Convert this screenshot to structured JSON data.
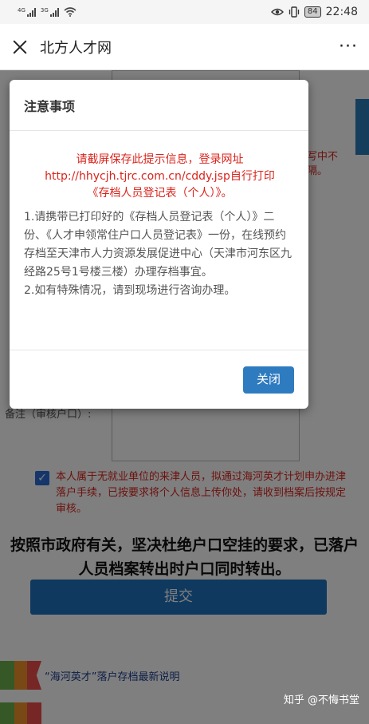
{
  "status_bar": {
    "signal1_label": "4G",
    "signal2_label": "3G",
    "battery": "84",
    "time": "22:48"
  },
  "titlebar": {
    "title": "北方人才网",
    "more": "···"
  },
  "page": {
    "side_red_line1": "填写中不",
    "side_red_line2": "间隔。",
    "remark_label": "备注（审核户口）:",
    "agree_text": "本人属于无就业单位的来津人员，拟通过海河英才计划申办进津落户手续，已按要求将个人信息上传你处，请收到档案后按规定审核。",
    "notice_bold": "按照市政府有关，坚决杜绝户口空挂的要求，已落户人员档案转出时户口同时转出。",
    "submit_label": "提交",
    "link_text": "“海河英才”落户存档最新说明",
    "watermark": "知乎 @不悔书堂"
  },
  "modal": {
    "title": "注意事项",
    "red_line1": "请截屏保存此提示信息，登录网址",
    "red_line2": "http://hhycjh.tjrc.com.cn/cddy.jsp自行打印",
    "red_line3": "《存档人员登记表（个人）》。",
    "item1": "1.请携带已打印好的《存档人员登记表（个人）》二份、《人才申领常住户口人员登记表》一份，在线预约存档至天津市人力资源发展促进中心（天津市河东区九经路25号1号楼三楼）办理存档事宜。",
    "item2": "2.如有特殊情况，请到现场进行咨询办理。",
    "close_label": "关闭"
  },
  "colors": {
    "accent_blue": "#1e73be",
    "warning_red": "#d9251d"
  },
  "icons": {
    "close": "close-icon",
    "more": "more-icon",
    "eye": "eye-icon",
    "vibrate": "vibrate-icon",
    "wifi": "wifi-icon",
    "checkbox": "checkbox-checked-icon"
  }
}
